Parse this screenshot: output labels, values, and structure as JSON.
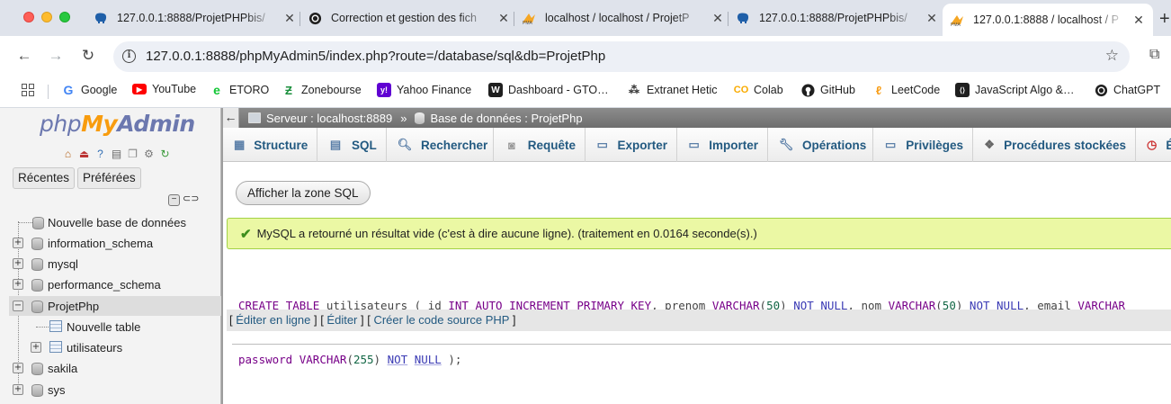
{
  "browser": {
    "tabs": [
      {
        "title": "127.0.0.1:8888/ProjetPHPbis/",
        "icon": "elephant-icon",
        "active": false
      },
      {
        "title": "Correction et gestion des fich",
        "icon": "chatgpt-icon",
        "active": false
      },
      {
        "title": "localhost / localhost / ProjetP",
        "icon": "pma-icon",
        "active": false
      },
      {
        "title": "127.0.0.1:8888/ProjetPHPbis/",
        "icon": "elephant-icon",
        "active": false
      },
      {
        "title": "127.0.0.1:8888 / localhost / P",
        "icon": "pma-icon",
        "active": true
      }
    ],
    "url": "127.0.0.1:8888/phpMyAdmin5/index.php?route=/database/sql&db=ProjetPhp",
    "bookmarks": [
      {
        "label": "Google",
        "icon": "google-icon"
      },
      {
        "label": "YouTube",
        "icon": "youtube-icon"
      },
      {
        "label": "ETORO",
        "icon": "etoro-icon"
      },
      {
        "label": "Zonebourse",
        "icon": "zonebourse-icon"
      },
      {
        "label": "Yahoo Finance",
        "icon": "yahoo-icon"
      },
      {
        "label": "Dashboard - GTO…",
        "icon": "gto-icon"
      },
      {
        "label": "Extranet Hetic",
        "icon": "hetic-icon"
      },
      {
        "label": "Colab",
        "icon": "colab-icon"
      },
      {
        "label": "GitHub",
        "icon": "github-icon"
      },
      {
        "label": "LeetCode",
        "icon": "leetcode-icon"
      },
      {
        "label": "JavaScript Algo &…",
        "icon": "js-algo-icon"
      },
      {
        "label": "ChatGPT",
        "icon": "chatgpt-icon"
      }
    ]
  },
  "pma_nav": {
    "logo": {
      "php": "php",
      "my": "My",
      "admin": "Admin"
    },
    "buttons": [
      "Récentes",
      "Préférées"
    ],
    "tree": [
      {
        "label": "Nouvelle base de données",
        "kind": "new-db"
      },
      {
        "label": "information_schema",
        "kind": "db"
      },
      {
        "label": "mysql",
        "kind": "db"
      },
      {
        "label": "performance_schema",
        "kind": "db"
      },
      {
        "label": "ProjetPhp",
        "kind": "db-open",
        "selected": true
      },
      {
        "label": "Nouvelle table",
        "kind": "new-table"
      },
      {
        "label": "utilisateurs",
        "kind": "table"
      },
      {
        "label": "sakila",
        "kind": "db"
      },
      {
        "label": "sys",
        "kind": "db"
      }
    ]
  },
  "pma_main": {
    "breadcrumb": {
      "server": "Serveur : localhost:8889",
      "separator": "»",
      "database": "Base de données : ProjetPhp"
    },
    "tabs": [
      {
        "label": "Structure",
        "icon": "structure-icon"
      },
      {
        "label": "SQL",
        "icon": "sql-icon"
      },
      {
        "label": "Rechercher",
        "icon": "search-icon"
      },
      {
        "label": "Requête",
        "icon": "query-icon"
      },
      {
        "label": "Exporter",
        "icon": "export-icon"
      },
      {
        "label": "Importer",
        "icon": "import-icon"
      },
      {
        "label": "Opérations",
        "icon": "wrench-icon"
      },
      {
        "label": "Privilèges",
        "icon": "privileges-icon"
      },
      {
        "label": "Procédures stockées",
        "icon": "routines-icon"
      },
      {
        "label": "É",
        "icon": "events-icon"
      }
    ],
    "show_sql_button": "Afficher la zone SQL",
    "success_message": "MySQL a retourné un résultat vide (c'est à dire aucune ligne). (traitement en 0.0164 seconde(s).)",
    "sql_line1_tokens": [
      {
        "t": "CREATE",
        "c": "kw"
      },
      {
        "t": " ",
        "c": ""
      },
      {
        "t": "TABLE",
        "c": "kw"
      },
      {
        "t": " utilisateurs ( id ",
        "c": ""
      },
      {
        "t": "INT",
        "c": "typ"
      },
      {
        "t": " ",
        "c": ""
      },
      {
        "t": "AUTO_INCREMENT",
        "c": "kw2"
      },
      {
        "t": " ",
        "c": ""
      },
      {
        "t": "PRIMARY KEY",
        "c": "kw2"
      },
      {
        "t": ", prenom ",
        "c": ""
      },
      {
        "t": "VARCHAR",
        "c": "typ"
      },
      {
        "t": "(",
        "c": ""
      },
      {
        "t": "50",
        "c": "num"
      },
      {
        "t": ") ",
        "c": ""
      },
      {
        "t": "NOT",
        "c": "kwn"
      },
      {
        "t": " ",
        "c": ""
      },
      {
        "t": "NULL",
        "c": "kwn"
      },
      {
        "t": ", nom ",
        "c": ""
      },
      {
        "t": "VARCHAR",
        "c": "typ"
      },
      {
        "t": "(",
        "c": ""
      },
      {
        "t": "50",
        "c": "num"
      },
      {
        "t": ") ",
        "c": ""
      },
      {
        "t": "NOT",
        "c": "kwn"
      },
      {
        "t": " ",
        "c": ""
      },
      {
        "t": "NULL",
        "c": "kwn"
      },
      {
        "t": ", email ",
        "c": ""
      },
      {
        "t": "VARCHAR",
        "c": "typ"
      }
    ],
    "sql_line2_tokens": [
      {
        "t": "password",
        "c": "kw2"
      },
      {
        "t": " ",
        "c": ""
      },
      {
        "t": "VARCHAR",
        "c": "typ"
      },
      {
        "t": "(",
        "c": ""
      },
      {
        "t": "255",
        "c": "num"
      },
      {
        "t": ") ",
        "c": ""
      },
      {
        "t": "NOT",
        "c": "kwn"
      },
      {
        "t": " ",
        "c": ""
      },
      {
        "t": "NULL",
        "c": "kwn"
      },
      {
        "t": " );",
        "c": ""
      }
    ],
    "links": {
      "edit_inline": "Éditer en ligne",
      "edit": "Éditer",
      "create_php": "Créer le code source PHP"
    }
  }
}
